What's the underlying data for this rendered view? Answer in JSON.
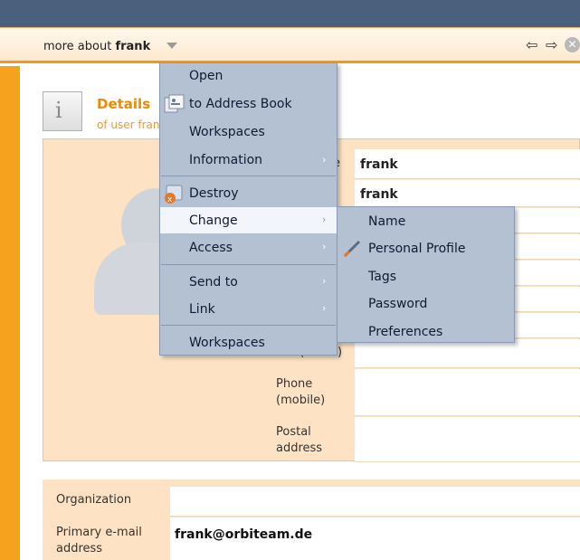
{
  "header": {
    "title_prefix": "more about",
    "title_user": "frank",
    "nav_back": "⇦",
    "nav_forward": "⇨",
    "nav_close": "✕"
  },
  "details": {
    "icon_glyph": "i",
    "title": "Details",
    "subtitle": "of user frank"
  },
  "form": {
    "name_label_fragment": "e",
    "name_value": "frank",
    "second_value": "frank",
    "fax_label": "Fax (home)",
    "phone_mobile_label": "Phone (mobile)",
    "postal_label": "Postal address",
    "organization_label": "Organization",
    "organization_value": "",
    "email_label": "Primary e-mail address",
    "email_value": "frank@orbiteam.de"
  },
  "context_menu": {
    "items": [
      {
        "label": "Open"
      },
      {
        "label": "to Address Book",
        "icon": "address-book-icon"
      },
      {
        "label": "Workspaces"
      },
      {
        "label": "Information",
        "submenu": true
      },
      {
        "label": "Destroy",
        "icon": "destroy-icon"
      },
      {
        "label": "Change",
        "submenu": true,
        "highlighted": true
      },
      {
        "label": "Access",
        "submenu": true
      },
      {
        "label": "Send to",
        "submenu": true
      },
      {
        "label": "Link",
        "submenu": true
      },
      {
        "label": "Workspaces"
      }
    ],
    "submenu_arrow": "›"
  },
  "change_submenu": {
    "items": [
      {
        "label": "Name"
      },
      {
        "label": "Personal Profile",
        "icon": "pencil-icon"
      },
      {
        "label": "Tags"
      },
      {
        "label": "Password"
      },
      {
        "label": "Preferences"
      }
    ]
  },
  "colors": {
    "topbar": "#4a607c",
    "accent_orange": "#f7a21d",
    "menu_bg": "#b4c1d2",
    "panel_bg": "#fde3c4"
  }
}
